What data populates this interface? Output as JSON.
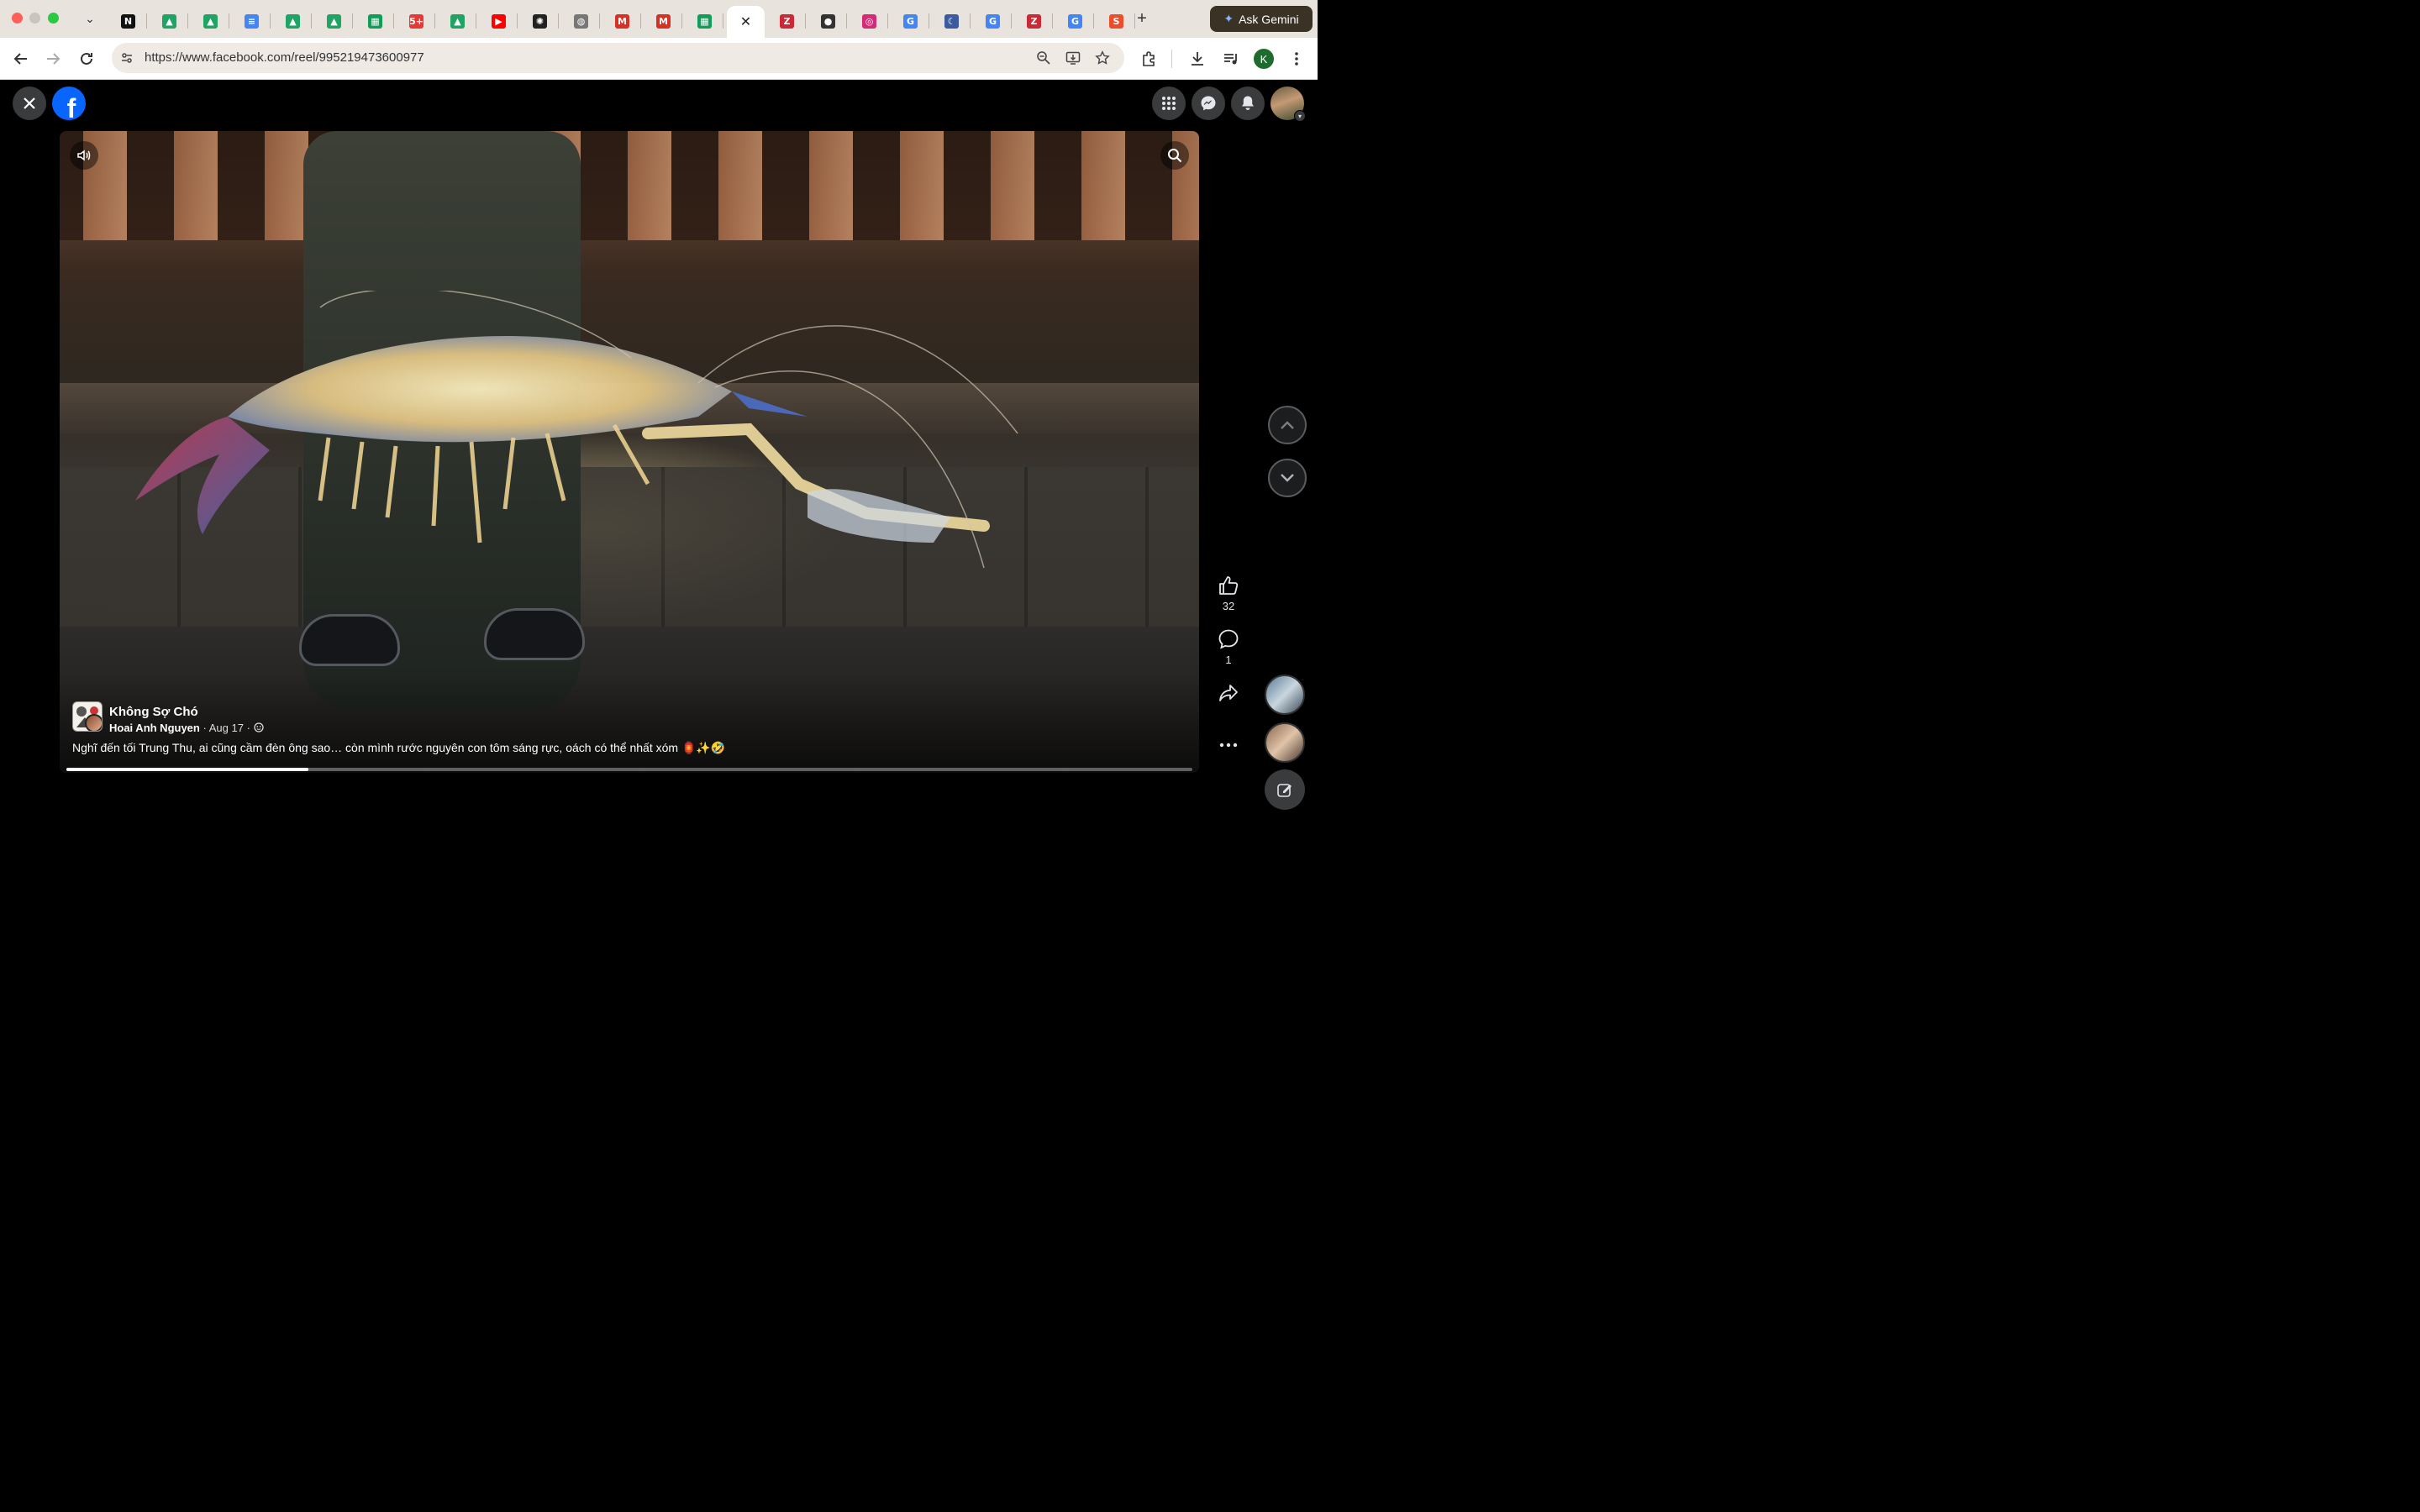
{
  "browser": {
    "url": "https://www.facebook.com/reel/995219473600977",
    "ask_gemini_label": "Ask Gemini",
    "profile_initial": "K",
    "tabs": [
      {
        "icon": "notion-icon",
        "glyph": "N",
        "color": "#111111"
      },
      {
        "icon": "google-drive-icon",
        "glyph": "▲",
        "color": "#1fa463"
      },
      {
        "icon": "google-drive-icon",
        "glyph": "▲",
        "color": "#1fa463"
      },
      {
        "icon": "google-docs-icon",
        "glyph": "≡",
        "color": "#4285f4"
      },
      {
        "icon": "google-drive-icon",
        "glyph": "▲",
        "color": "#1fa463"
      },
      {
        "icon": "google-drive-icon",
        "glyph": "▲",
        "color": "#1fa463"
      },
      {
        "icon": "google-sheets-icon",
        "glyph": "▦",
        "color": "#0f9d58"
      },
      {
        "icon": "notification-app-icon",
        "glyph": "5+",
        "color": "#e53935"
      },
      {
        "icon": "google-drive-icon",
        "glyph": "▲",
        "color": "#1fa463"
      },
      {
        "icon": "youtube-icon",
        "glyph": "▶",
        "color": "#ff0000"
      },
      {
        "icon": "chatgpt-icon",
        "glyph": "✺",
        "color": "#222222"
      },
      {
        "icon": "globe-icon",
        "glyph": "◍",
        "color": "#777777"
      },
      {
        "icon": "gmail-icon",
        "glyph": "M",
        "color": "#d93025"
      },
      {
        "icon": "gmail-icon",
        "glyph": "M",
        "color": "#d93025"
      },
      {
        "icon": "google-sheets-icon",
        "glyph": "▦",
        "color": "#0f9d58"
      },
      {
        "icon": "close-icon",
        "glyph": "✕",
        "color": "#ffffff",
        "active": true
      },
      {
        "icon": "zotero-icon",
        "glyph": "Z",
        "color": "#cc2936"
      },
      {
        "icon": "app-icon",
        "glyph": "●",
        "color": "#333333"
      },
      {
        "icon": "instagram-icon",
        "glyph": "◎",
        "color": "#d62976"
      },
      {
        "icon": "google-translate-icon",
        "glyph": "G",
        "color": "#4285f4"
      },
      {
        "icon": "swift-icon",
        "glyph": "☾",
        "color": "#3a5ba0"
      },
      {
        "icon": "google-translate-icon",
        "glyph": "G",
        "color": "#4285f4"
      },
      {
        "icon": "zotero-icon",
        "glyph": "Z",
        "color": "#cc2936"
      },
      {
        "icon": "google-icon",
        "glyph": "G",
        "color": "#4285f4"
      },
      {
        "icon": "shopping-bag-icon",
        "glyph": "S",
        "color": "#ee4d2d"
      }
    ]
  },
  "reel": {
    "group_name": "Không Sợ Chó",
    "author": "Hoai Anh Nguyen",
    "date": "Aug 17",
    "separator": "·",
    "caption": "Nghĩ đến tối Trung Thu, ai cũng cầm đèn ông sao… còn mình rước nguyên con tôm sáng rực, oách có thể nhất xóm 🏮✨🤣",
    "progress_fraction": 0.215,
    "likes": "32",
    "comments": "1"
  },
  "colors": {
    "facebook_blue": "#0866ff",
    "background": "#000000"
  }
}
